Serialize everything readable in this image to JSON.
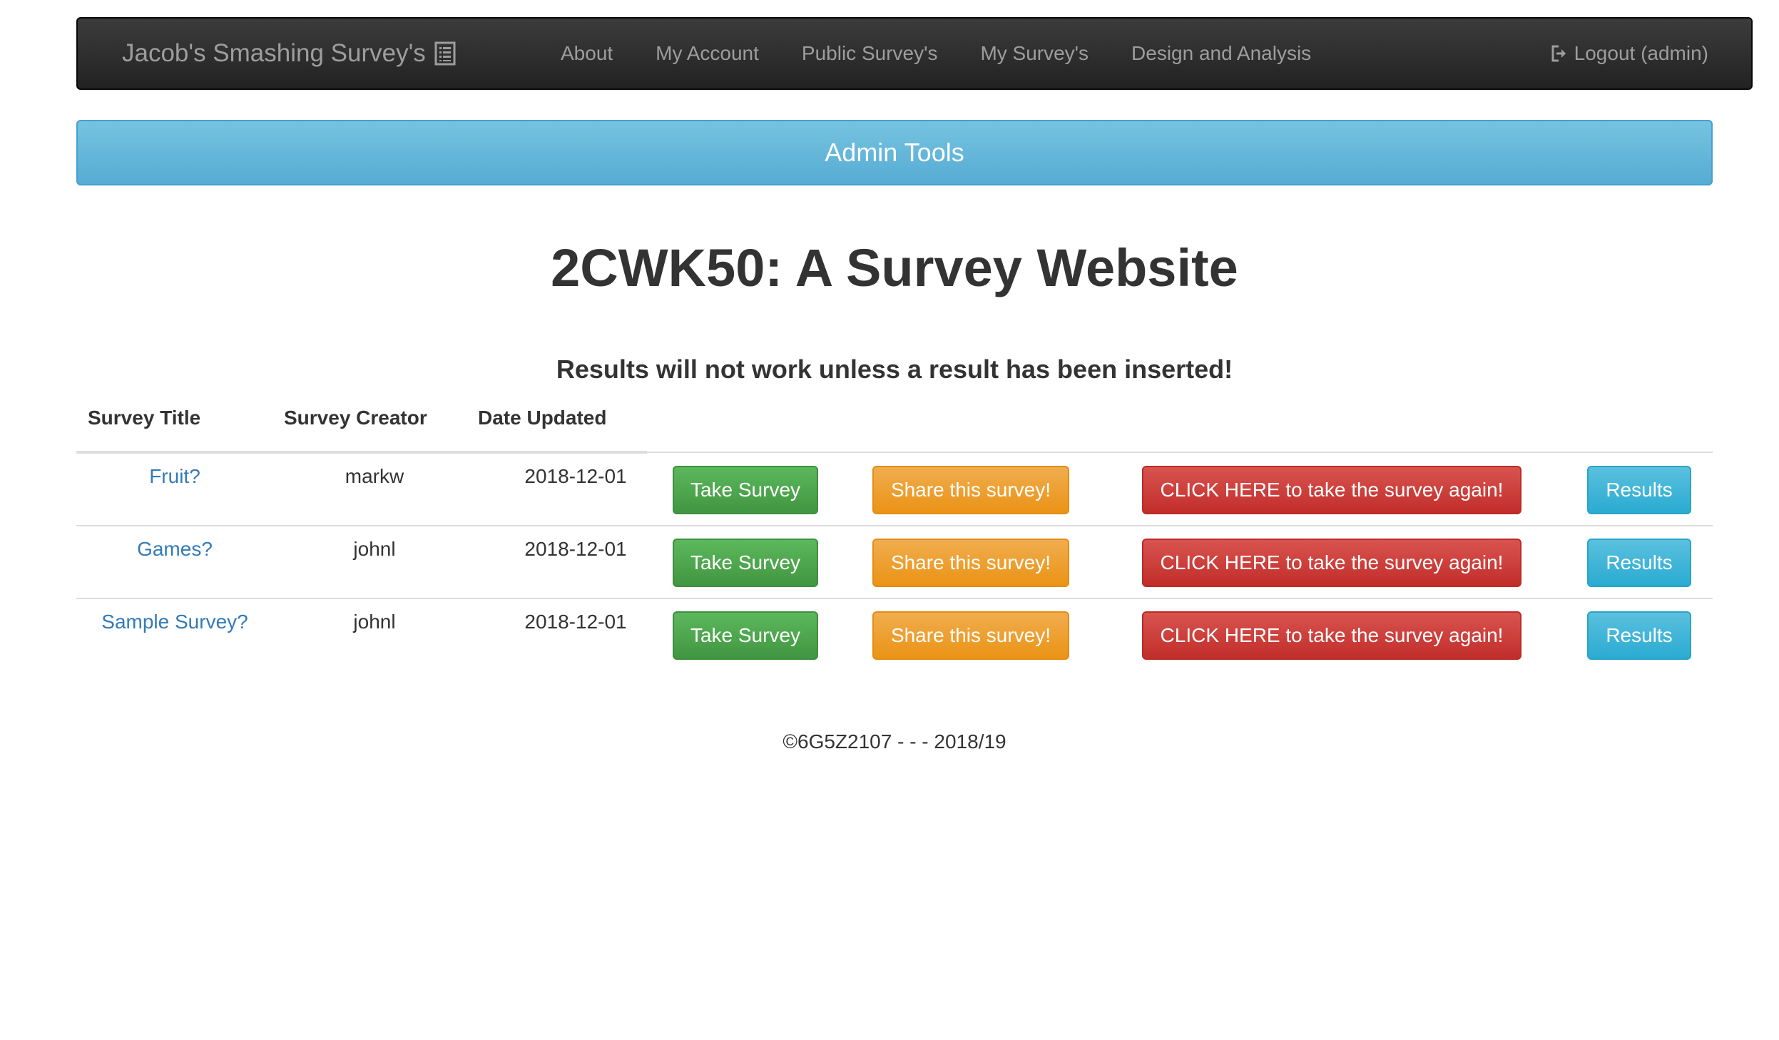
{
  "navbar": {
    "brand": "Jacob's Smashing Survey's",
    "brand_icon": "list-icon",
    "links": [
      "About",
      "My Account",
      "Public Survey's",
      "My Survey's",
      "Design and Analysis"
    ],
    "logout_label": "Logout (admin)",
    "logout_icon": "logout-icon"
  },
  "admin_bar": {
    "label": "Admin Tools"
  },
  "page_title": "2CWK50: A Survey Website",
  "notice": "Results will not work unless a result has been inserted!",
  "table": {
    "headers": [
      "Survey Title",
      "Survey Creator",
      "Date Updated"
    ],
    "rows": [
      {
        "title": "Fruit?",
        "creator": "markw",
        "date": "2018-12-01",
        "take_label": "Take Survey",
        "share_label": "Share this survey!",
        "again_label": "CLICK HERE to take the survey again!",
        "results_label": "Results"
      },
      {
        "title": "Games?",
        "creator": "johnl",
        "date": "2018-12-01",
        "take_label": "Take Survey",
        "share_label": "Share this survey!",
        "again_label": "CLICK HERE to take the survey again!",
        "results_label": "Results"
      },
      {
        "title": "Sample Survey?",
        "creator": "johnl",
        "date": "2018-12-01",
        "take_label": "Take Survey",
        "share_label": "Share this survey!",
        "again_label": "CLICK HERE to take the survey again!",
        "results_label": "Results"
      }
    ]
  },
  "footer": "©6G5Z2107 - - - 2018/19",
  "colors": {
    "navbar_bg": "#222222",
    "nav_text": "#9d9d9d",
    "admin_bar": "#5bc0de",
    "link": "#337ab7",
    "success": "#5cb85c",
    "warning": "#f0ad4e",
    "danger": "#d9534f",
    "info": "#5bc0de"
  }
}
